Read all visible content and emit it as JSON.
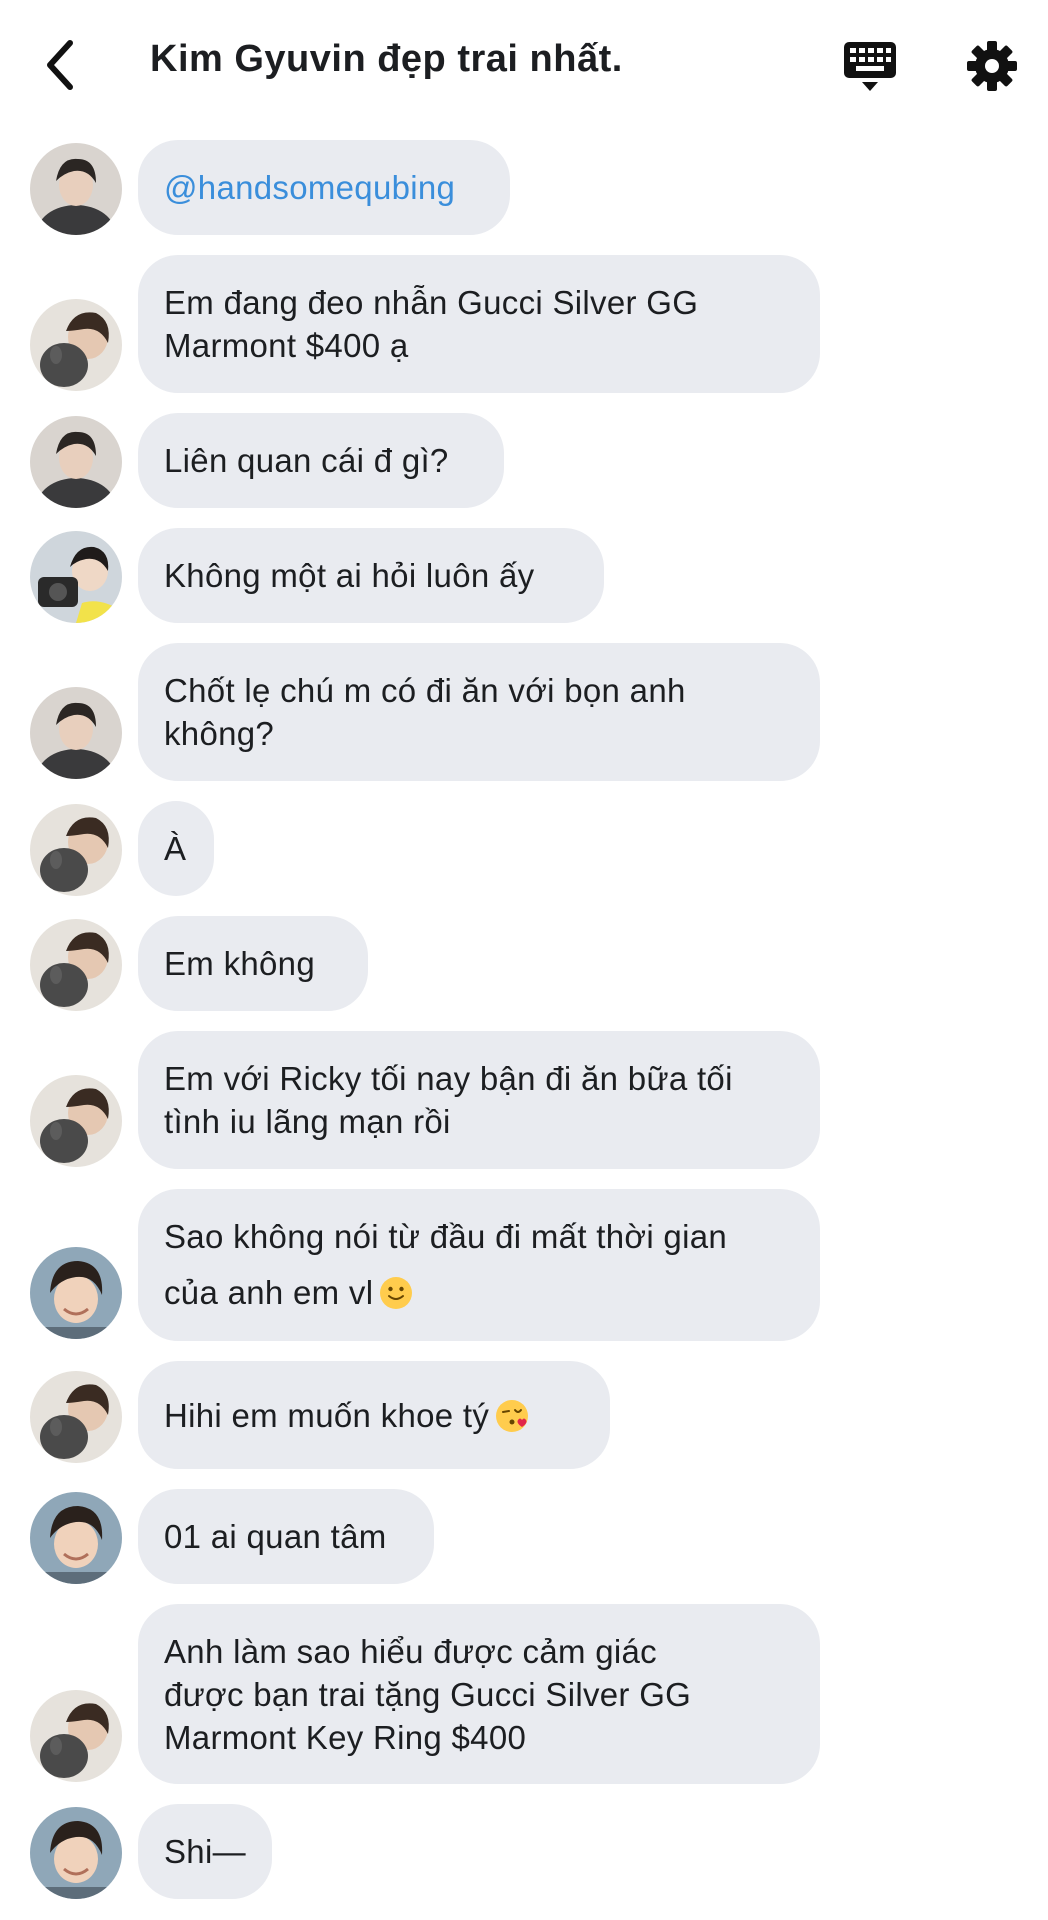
{
  "header": {
    "back_icon": "chevron-left-icon",
    "title": "Kim Gyuvin đẹp trai nhất.",
    "keyboard_icon": "keyboard-icon",
    "settings_icon": "gear-icon"
  },
  "colors": {
    "bubble": "#e9ebf0",
    "mention": "#3a8edb",
    "text": "#1c1e21"
  },
  "messages": [
    {
      "avatar": "avatar-gray-shirt",
      "text": "@handsomequbing",
      "is_mention": true
    },
    {
      "avatar": "avatar-with-dog",
      "text": "Em đang đeo nhẫn Gucci Silver GG\nMarmont $400 ạ"
    },
    {
      "avatar": "avatar-gray-shirt",
      "text": "Liên quan cái đ gì?"
    },
    {
      "avatar": "avatar-with-camera",
      "text": "Không một ai hỏi luôn ấy"
    },
    {
      "avatar": "avatar-gray-shirt",
      "text": "Chốt lẹ chú m có đi ăn với bọn anh\nkhông?"
    },
    {
      "avatar": "avatar-with-dog",
      "text": "À"
    },
    {
      "avatar": "avatar-with-dog",
      "text": "Em không"
    },
    {
      "avatar": "avatar-with-dog",
      "text": "Em với Ricky tối nay bận đi ăn bữa tối\ntình iu lãng mạn rồi"
    },
    {
      "avatar": "avatar-smiling",
      "text": "Sao không nói từ đầu đi mất thời gian\ncủa anh em vl",
      "emoji": "slightly-smiling-face-icon"
    },
    {
      "avatar": "avatar-with-dog",
      "text": "Hihi em muốn khoe tý",
      "emoji": "face-blowing-kiss-icon"
    },
    {
      "avatar": "avatar-smiling",
      "text": "01 ai quan tâm"
    },
    {
      "avatar": "avatar-with-dog",
      "text": "Anh làm sao hiểu được cảm giác\nđược bạn trai tặng Gucci Silver GG\nMarmont Key Ring $400"
    },
    {
      "avatar": "avatar-smiling",
      "text": "Shi—"
    }
  ]
}
